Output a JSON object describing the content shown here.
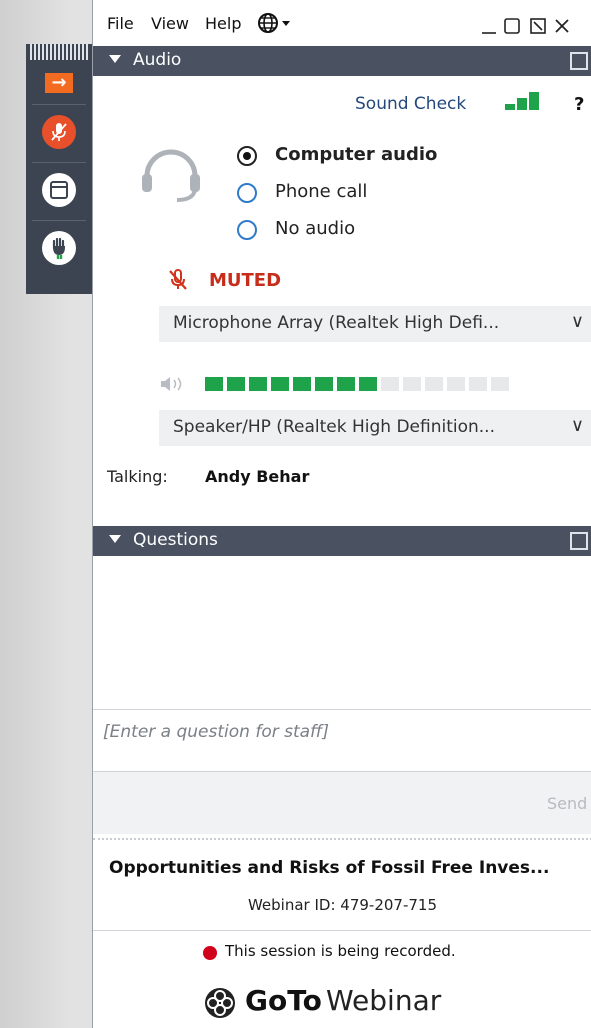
{
  "menubar": {
    "items": [
      "File",
      "View",
      "Help"
    ],
    "globe_icon": "globe-icon",
    "controls": [
      "minimize-icon",
      "maximize-icon",
      "popout-icon",
      "close-icon"
    ]
  },
  "toolbar": {
    "buttons": [
      "arrow-right-icon",
      "microphone-muted-icon",
      "window-icon",
      "raise-hand-icon"
    ],
    "colors": {
      "arrow": "#f26b21",
      "mic": "#e8502b",
      "dark": "#3c4452"
    }
  },
  "audio": {
    "header": "Audio",
    "sound_check": "Sound Check",
    "help": "?",
    "options": [
      "Computer audio",
      "Phone call",
      "No audio"
    ],
    "selected_option": "Computer audio",
    "muted": "MUTED",
    "microphone": "Microphone Array (Realtek High Defi...",
    "speaker": "Speaker/HP (Realtek High Definition...",
    "speaker_level": 0.57,
    "talking_label": "Talking:",
    "talking_name": "Andy Behar"
  },
  "questions": {
    "header": "Questions",
    "placeholder": "[Enter a question for staff]",
    "send": "Send"
  },
  "footer": {
    "title": "Opportunities and Risks of Fossil Free Inves...",
    "webinar_id": "Webinar ID: 479-207-715",
    "recording": "This session is being recorded.",
    "brand_goto": "GoTo",
    "brand_webinar": "Webinar",
    "recording_color": "#d0021b"
  }
}
